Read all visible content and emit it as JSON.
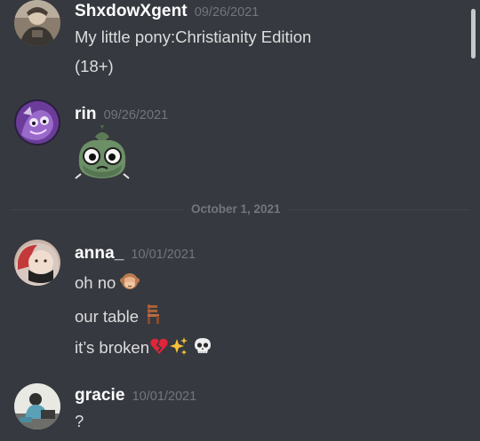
{
  "messages": [
    {
      "username": "ShxdowXgent",
      "timestamp": "09/26/2021",
      "lines": [
        "My little pony:Christianity Edition",
        "(18+)"
      ]
    },
    {
      "username": "rin",
      "timestamp": "09/26/2021",
      "sticker": "bag-creature-sticker"
    },
    {
      "username": "anna_",
      "timestamp": "10/01/2021",
      "lines": [
        "oh no",
        "our table",
        "it’s broken"
      ],
      "emojis": [
        "see-no-evil-monkey-emoji",
        "chair-emoji",
        "broken-heart-emoji",
        "sparkles-emoji",
        "skull-emoji"
      ]
    },
    {
      "username": "gracie",
      "timestamp": "10/01/2021",
      "lines": [
        "?"
      ]
    }
  ],
  "date_divider": "October 1, 2021",
  "colors": {
    "background": "#36393f",
    "username": "#ffffff",
    "timestamp": "#72767d",
    "message_text": "#dcddde",
    "divider": "#42454a"
  }
}
